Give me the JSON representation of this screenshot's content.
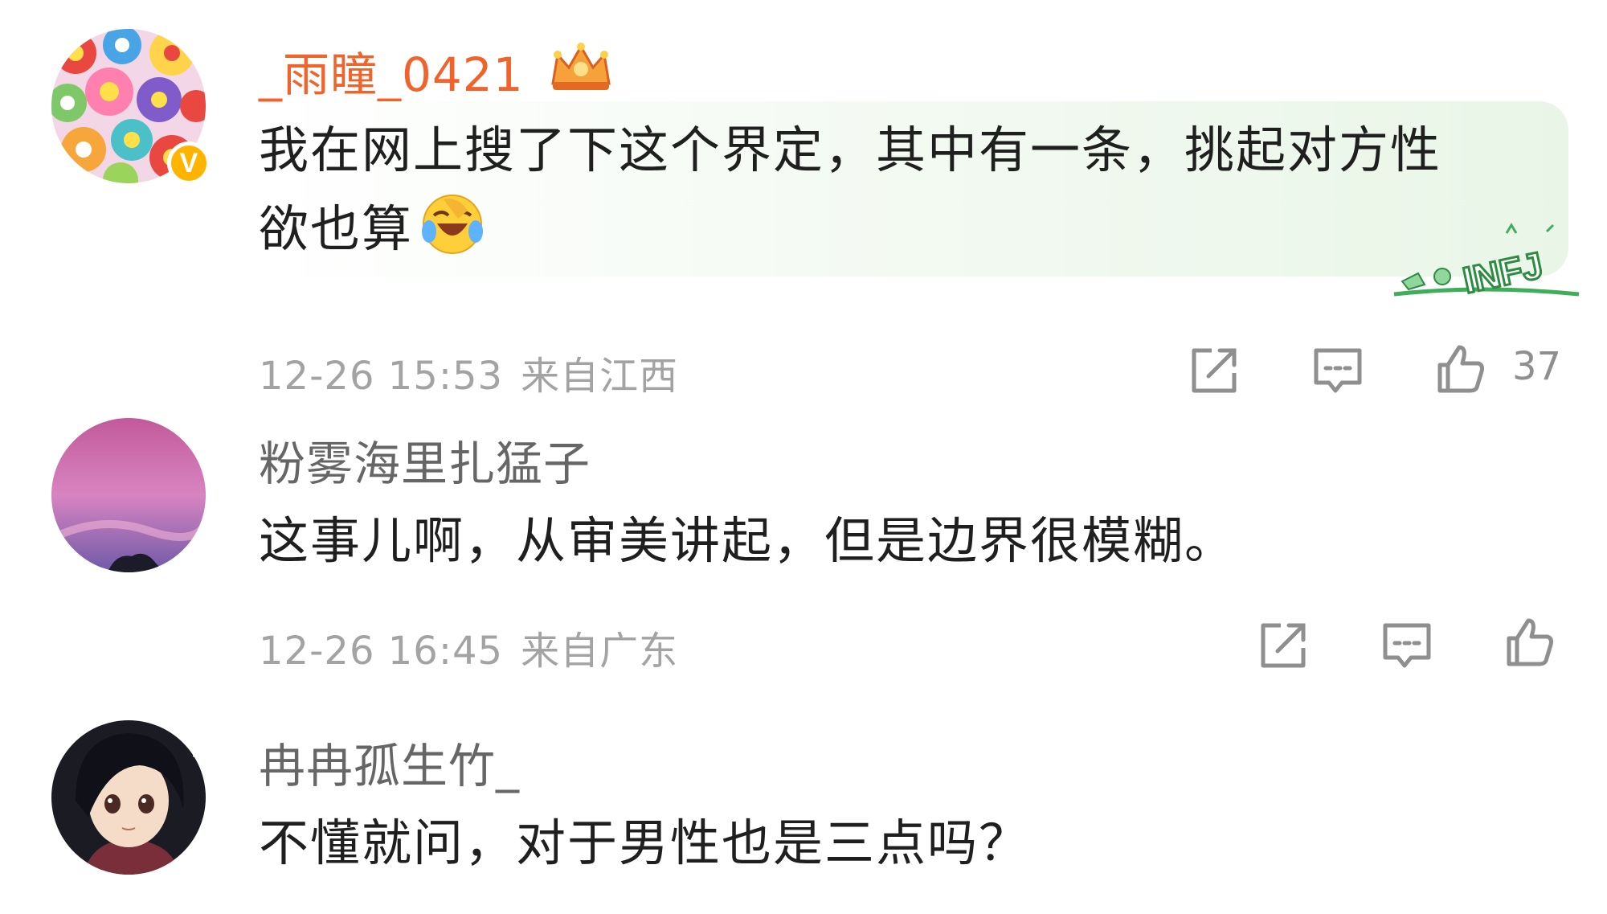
{
  "comments": [
    {
      "username": "_雨瞳_0421",
      "verified_badge": "V",
      "vip_icon": "crown-icon",
      "text_line1": "我在网上搜了下这个界定，其中有一条，挑起对方性",
      "text_line2": "欲也算",
      "emoji": "facepalm-laugh-emoji",
      "sticker": "INFJ",
      "date": "12-26 15:53",
      "location": "来自江西",
      "like_count": "37"
    },
    {
      "username": "粉雾海里扎猛子",
      "text": "这事儿啊，从审美讲起，但是边界很模糊。",
      "date": "12-26 16:45",
      "location": "来自广东"
    },
    {
      "username": "冉冉孤生竹_",
      "text": "不懂就问，对于男性也是三点吗？"
    }
  ],
  "colors": {
    "vip_name": "#f0642b",
    "name": "#666666",
    "meta": "#a3a3a3",
    "badge": "#ffb400",
    "bubble_green": "#e9f6e7"
  }
}
